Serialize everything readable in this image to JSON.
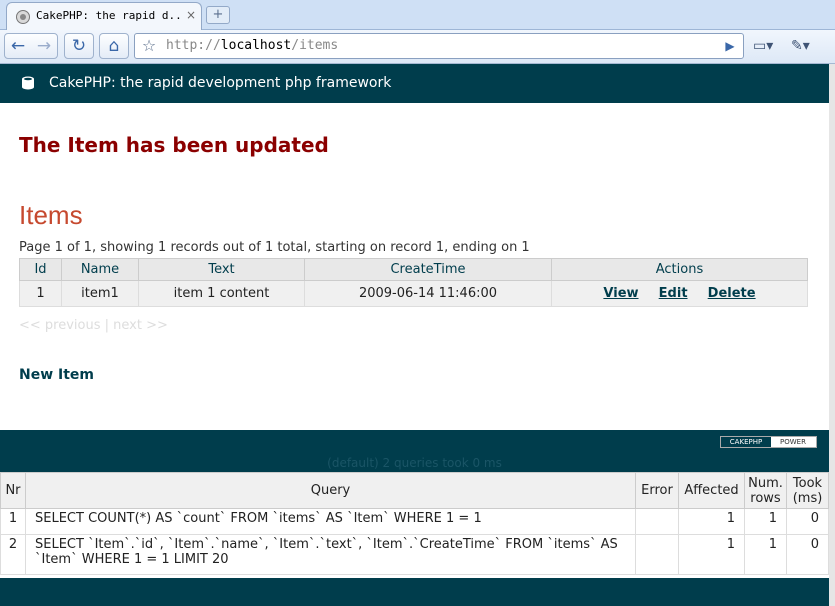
{
  "browser": {
    "tab_title": "CakePHP: the rapid d...",
    "tab_close": "×",
    "newtab": "+",
    "url_scheme": "http://",
    "url_host": "localhost",
    "url_path": "/items",
    "back": "←",
    "forward": "→",
    "reload": "↻",
    "home": "⌂",
    "star": "☆",
    "go": "▶",
    "page_menu": "▭▾",
    "tools_menu": "✎▾"
  },
  "header": {
    "title": "CakePHP: the rapid development php framework"
  },
  "flash": "The Item has been updated",
  "heading": "Items",
  "paging_info": "Page 1 of 1, showing 1 records out of 1 total, starting on record 1, ending on 1",
  "items_table": {
    "headers": [
      "Id",
      "Name",
      "Text",
      "CreateTime",
      "Actions"
    ],
    "rows": [
      {
        "id": "1",
        "name": "item1",
        "text": "item 1 content",
        "created": "2009-06-14 11:46:00"
      }
    ],
    "actions": {
      "view": "View",
      "edit": "Edit",
      "delete": "Delete"
    }
  },
  "pager": {
    "previous": "<< previous",
    "sep": "|",
    "next": "next >>"
  },
  "new_item": "New Item",
  "powered": {
    "cake": "CAKEPHP",
    "power": "POWER"
  },
  "sql": {
    "caption": "(default) 2 queries took 0 ms",
    "headers": [
      "Nr",
      "Query",
      "Error",
      "Affected",
      "Num. rows",
      "Took (ms)"
    ],
    "rows": [
      {
        "nr": "1",
        "query": "SELECT COUNT(*) AS `count` FROM `items` AS `Item` WHERE 1 = 1",
        "error": "",
        "affected": "1",
        "num_rows": "1",
        "took": "0"
      },
      {
        "nr": "2",
        "query": "SELECT `Item`.`id`, `Item`.`name`, `Item`.`text`, `Item`.`CreateTime` FROM `items` AS `Item` WHERE 1 = 1 LIMIT 20",
        "error": "",
        "affected": "1",
        "num_rows": "1",
        "took": "0"
      }
    ]
  }
}
